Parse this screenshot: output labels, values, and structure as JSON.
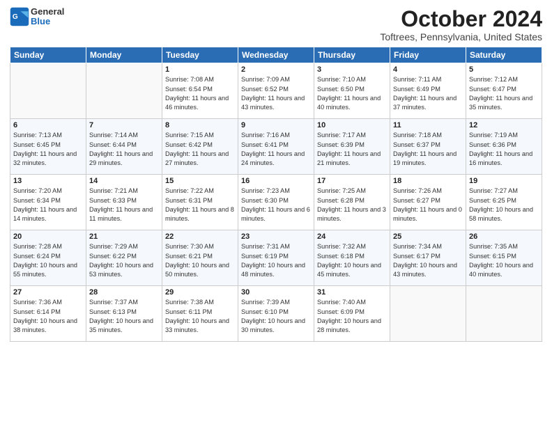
{
  "logo": {
    "general": "General",
    "blue": "Blue"
  },
  "header": {
    "title": "October 2024",
    "location": "Toftrees, Pennsylvania, United States"
  },
  "days": [
    "Sunday",
    "Monday",
    "Tuesday",
    "Wednesday",
    "Thursday",
    "Friday",
    "Saturday"
  ],
  "weeks": [
    [
      {
        "day": "",
        "info": ""
      },
      {
        "day": "",
        "info": ""
      },
      {
        "day": "1",
        "info": "Sunrise: 7:08 AM\nSunset: 6:54 PM\nDaylight: 11 hours and 46 minutes."
      },
      {
        "day": "2",
        "info": "Sunrise: 7:09 AM\nSunset: 6:52 PM\nDaylight: 11 hours and 43 minutes."
      },
      {
        "day": "3",
        "info": "Sunrise: 7:10 AM\nSunset: 6:50 PM\nDaylight: 11 hours and 40 minutes."
      },
      {
        "day": "4",
        "info": "Sunrise: 7:11 AM\nSunset: 6:49 PM\nDaylight: 11 hours and 37 minutes."
      },
      {
        "day": "5",
        "info": "Sunrise: 7:12 AM\nSunset: 6:47 PM\nDaylight: 11 hours and 35 minutes."
      }
    ],
    [
      {
        "day": "6",
        "info": "Sunrise: 7:13 AM\nSunset: 6:45 PM\nDaylight: 11 hours and 32 minutes."
      },
      {
        "day": "7",
        "info": "Sunrise: 7:14 AM\nSunset: 6:44 PM\nDaylight: 11 hours and 29 minutes."
      },
      {
        "day": "8",
        "info": "Sunrise: 7:15 AM\nSunset: 6:42 PM\nDaylight: 11 hours and 27 minutes."
      },
      {
        "day": "9",
        "info": "Sunrise: 7:16 AM\nSunset: 6:41 PM\nDaylight: 11 hours and 24 minutes."
      },
      {
        "day": "10",
        "info": "Sunrise: 7:17 AM\nSunset: 6:39 PM\nDaylight: 11 hours and 21 minutes."
      },
      {
        "day": "11",
        "info": "Sunrise: 7:18 AM\nSunset: 6:37 PM\nDaylight: 11 hours and 19 minutes."
      },
      {
        "day": "12",
        "info": "Sunrise: 7:19 AM\nSunset: 6:36 PM\nDaylight: 11 hours and 16 minutes."
      }
    ],
    [
      {
        "day": "13",
        "info": "Sunrise: 7:20 AM\nSunset: 6:34 PM\nDaylight: 11 hours and 14 minutes."
      },
      {
        "day": "14",
        "info": "Sunrise: 7:21 AM\nSunset: 6:33 PM\nDaylight: 11 hours and 11 minutes."
      },
      {
        "day": "15",
        "info": "Sunrise: 7:22 AM\nSunset: 6:31 PM\nDaylight: 11 hours and 8 minutes."
      },
      {
        "day": "16",
        "info": "Sunrise: 7:23 AM\nSunset: 6:30 PM\nDaylight: 11 hours and 6 minutes."
      },
      {
        "day": "17",
        "info": "Sunrise: 7:25 AM\nSunset: 6:28 PM\nDaylight: 11 hours and 3 minutes."
      },
      {
        "day": "18",
        "info": "Sunrise: 7:26 AM\nSunset: 6:27 PM\nDaylight: 11 hours and 0 minutes."
      },
      {
        "day": "19",
        "info": "Sunrise: 7:27 AM\nSunset: 6:25 PM\nDaylight: 10 hours and 58 minutes."
      }
    ],
    [
      {
        "day": "20",
        "info": "Sunrise: 7:28 AM\nSunset: 6:24 PM\nDaylight: 10 hours and 55 minutes."
      },
      {
        "day": "21",
        "info": "Sunrise: 7:29 AM\nSunset: 6:22 PM\nDaylight: 10 hours and 53 minutes."
      },
      {
        "day": "22",
        "info": "Sunrise: 7:30 AM\nSunset: 6:21 PM\nDaylight: 10 hours and 50 minutes."
      },
      {
        "day": "23",
        "info": "Sunrise: 7:31 AM\nSunset: 6:19 PM\nDaylight: 10 hours and 48 minutes."
      },
      {
        "day": "24",
        "info": "Sunrise: 7:32 AM\nSunset: 6:18 PM\nDaylight: 10 hours and 45 minutes."
      },
      {
        "day": "25",
        "info": "Sunrise: 7:34 AM\nSunset: 6:17 PM\nDaylight: 10 hours and 43 minutes."
      },
      {
        "day": "26",
        "info": "Sunrise: 7:35 AM\nSunset: 6:15 PM\nDaylight: 10 hours and 40 minutes."
      }
    ],
    [
      {
        "day": "27",
        "info": "Sunrise: 7:36 AM\nSunset: 6:14 PM\nDaylight: 10 hours and 38 minutes."
      },
      {
        "day": "28",
        "info": "Sunrise: 7:37 AM\nSunset: 6:13 PM\nDaylight: 10 hours and 35 minutes."
      },
      {
        "day": "29",
        "info": "Sunrise: 7:38 AM\nSunset: 6:11 PM\nDaylight: 10 hours and 33 minutes."
      },
      {
        "day": "30",
        "info": "Sunrise: 7:39 AM\nSunset: 6:10 PM\nDaylight: 10 hours and 30 minutes."
      },
      {
        "day": "31",
        "info": "Sunrise: 7:40 AM\nSunset: 6:09 PM\nDaylight: 10 hours and 28 minutes."
      },
      {
        "day": "",
        "info": ""
      },
      {
        "day": "",
        "info": ""
      }
    ]
  ]
}
